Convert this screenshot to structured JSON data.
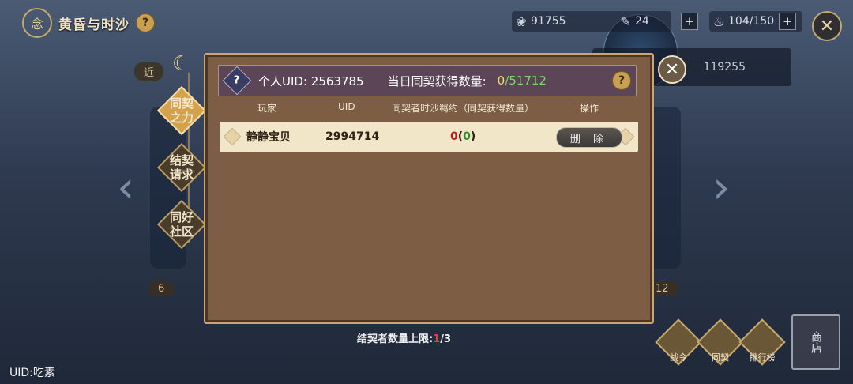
{
  "header": {
    "title": "黄昏与时沙",
    "help": "?"
  },
  "resources": [
    {
      "icon": "rose-icon",
      "value": "91755"
    },
    {
      "icon": "feather-icon",
      "value": "24"
    },
    {
      "icon": "drumstick-icon",
      "value": "104/150"
    }
  ],
  "plus": "+",
  "close": "✕",
  "background": {
    "info_text": "119255",
    "left_pill": "近",
    "left_bottom": "6",
    "right_bottom": "12"
  },
  "tabs": [
    {
      "label1": "同契",
      "label2": "之力"
    },
    {
      "label1": "结契",
      "label2": "请求"
    },
    {
      "label1": "同好",
      "label2": "社区"
    }
  ],
  "dialog": {
    "uid_label": "个人UID: 2563785",
    "daily_label": "当日同契获得数量:",
    "daily_current": "0",
    "daily_total": "/51712",
    "columns": [
      "玩家",
      "UID",
      "同契者时沙羁约（同契获得数量）",
      "操作"
    ],
    "rows": [
      {
        "player": "静静宝贝",
        "uid": "2994714",
        "value": "0",
        "gain": "0",
        "action": "删 除"
      }
    ]
  },
  "limit": {
    "prefix": "结契者数量上限:",
    "current": "1",
    "max": "/3"
  },
  "bottom_uid": "UID:吃素",
  "bottom_buttons": [
    "战令",
    "同契",
    "排行榜"
  ],
  "shop": "商店"
}
